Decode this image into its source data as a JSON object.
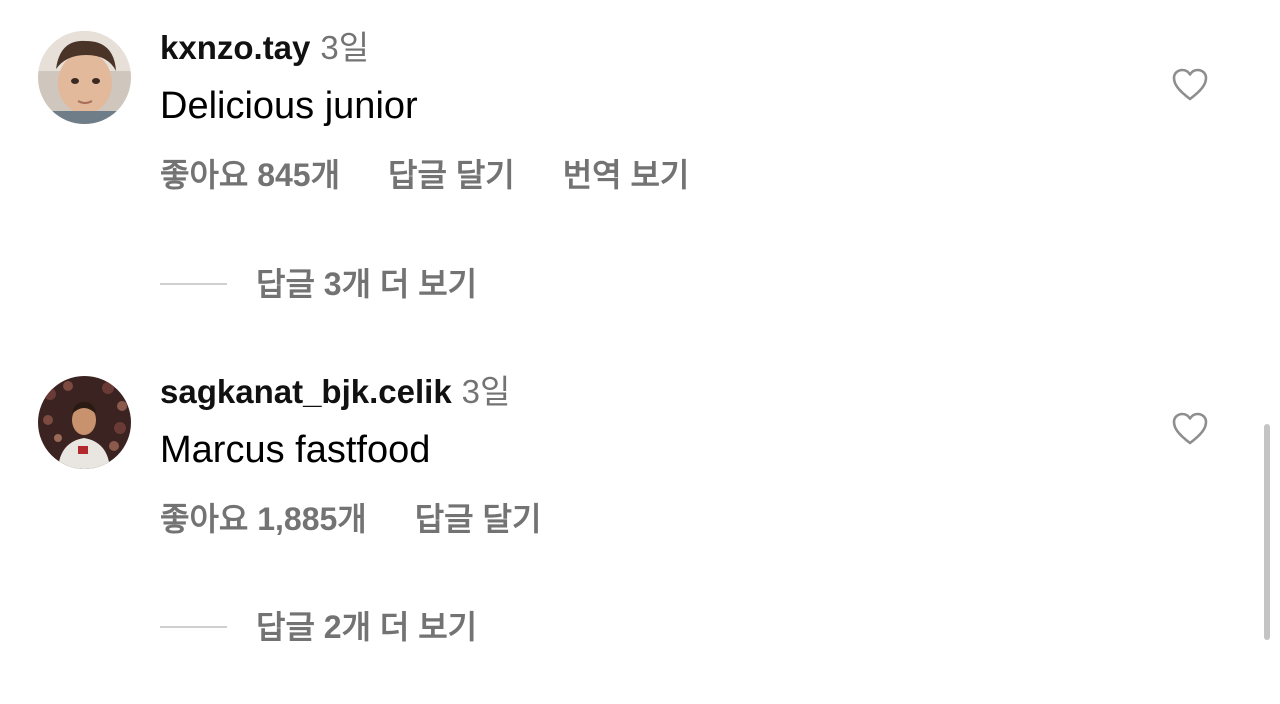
{
  "comments": [
    {
      "username": "kxnzo.tay",
      "time": "3일",
      "text": "Delicious junior",
      "actions": {
        "likes": "좋아요 845개",
        "reply": "답글 달기",
        "translate": "번역 보기"
      },
      "replies_label": "답글 3개 더 보기"
    },
    {
      "username": "sagkanat_bjk.celik",
      "time": "3일",
      "text": "Marcus fastfood",
      "actions": {
        "likes": "좋아요 1,885개",
        "reply": "답글 달기"
      },
      "replies_label": "답글 2개 더 보기"
    }
  ],
  "colors": {
    "secondary_text": "#737373",
    "divider": "#d0d0d0"
  },
  "icons": {
    "like": "heart-outline-icon"
  }
}
